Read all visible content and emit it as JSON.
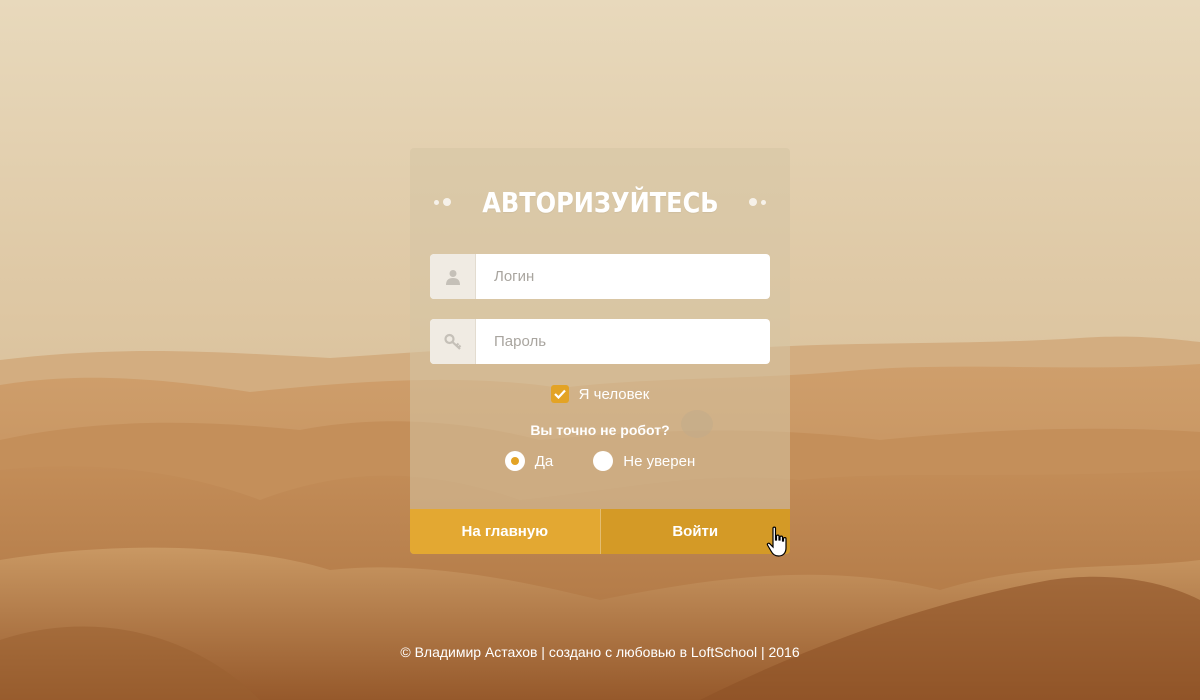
{
  "form": {
    "title": "АВТОРИЗУЙТЕСЬ",
    "login_placeholder": "Логин",
    "password_placeholder": "Пароль",
    "human_checkbox_label": "Я человек",
    "human_checked": true,
    "robot_question": "Вы точно не робот?",
    "radio_options": [
      {
        "label": "Да",
        "checked": true
      },
      {
        "label": "Не уверен",
        "checked": false
      }
    ],
    "home_button": "На главную",
    "login_button": "Войти"
  },
  "footer": {
    "text": "© Владимир Астахов | создано с любовью в LoftSchool | 2016"
  },
  "icons": {
    "login": "user-icon",
    "password": "key-icon",
    "cursor": "hand-pointer-icon"
  },
  "colors": {
    "accent": "#e3a325",
    "button_home": "#e3a832",
    "button_login": "#d49a26"
  }
}
